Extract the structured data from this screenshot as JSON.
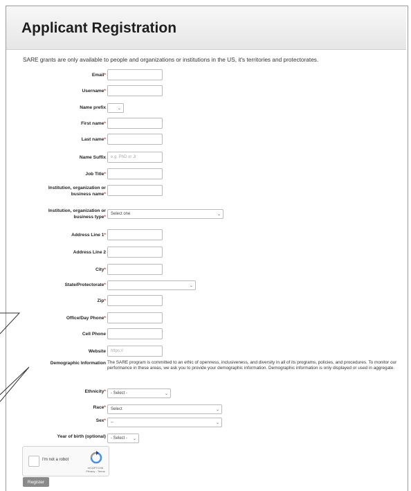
{
  "page": {
    "title": "Applicant Registration",
    "intro": "SARE grants are only available to people and organizations or institutions in the US, it's territories and protectorates."
  },
  "fields": [
    {
      "label": "Email",
      "required": true,
      "type": "text",
      "placeholder": ""
    },
    {
      "label": "Username",
      "required": true,
      "type": "text",
      "placeholder": ""
    },
    {
      "label": "Name prefix",
      "required": false,
      "type": "select-small",
      "value": ""
    },
    {
      "label": "First name",
      "required": true,
      "type": "text",
      "placeholder": ""
    },
    {
      "label": "Last name",
      "required": true,
      "type": "text",
      "placeholder": ""
    },
    {
      "label": "Name Suffix",
      "required": false,
      "type": "text",
      "placeholder": "e.g. PhD or Jr"
    },
    {
      "label": "Job Title",
      "required": true,
      "type": "text",
      "placeholder": ""
    },
    {
      "label": "Institution, organization or business name",
      "required": true,
      "type": "text",
      "placeholder": ""
    },
    {
      "label": "Institution, organization or business type",
      "required": true,
      "type": "select",
      "value": "Select one"
    },
    {
      "label": "Address Line 1",
      "required": true,
      "type": "text",
      "placeholder": ""
    },
    {
      "label": "Address Line 2",
      "required": false,
      "type": "text",
      "placeholder": ""
    },
    {
      "label": "City",
      "required": true,
      "type": "text",
      "placeholder": ""
    },
    {
      "label": "State/Protectorate",
      "required": true,
      "type": "select",
      "value": ""
    },
    {
      "label": "Zip",
      "required": true,
      "type": "text",
      "placeholder": ""
    },
    {
      "label": "Office/Day Phone",
      "required": true,
      "type": "text",
      "placeholder": ""
    },
    {
      "label": "Cell Phone",
      "required": false,
      "type": "text",
      "placeholder": ""
    },
    {
      "label": "Website",
      "required": false,
      "type": "text",
      "placeholder": "https://"
    }
  ],
  "demographic": {
    "label": "Demographic Information",
    "text": "The SARE program is committed to an ethic of openness, inclusiveness, and diversity in all of its programs, policies, and procedures. To monitor our performance in these areas, we ask you to provide your demographic information. Demographic information is only displayed or used in aggregate."
  },
  "demo_fields": [
    {
      "label": "Ethnicity",
      "required": true,
      "value": "- Select -"
    },
    {
      "label": "Race",
      "required": true,
      "value": "Select"
    },
    {
      "label": "Sex",
      "required": true,
      "value": "--"
    },
    {
      "label": "Year of birth (optional)",
      "required": false,
      "value": "- Select -"
    }
  ],
  "captcha": {
    "label": "I'm not a robot",
    "brand": "reCAPTCHA",
    "links": "Privacy - Terms"
  },
  "register_label": "Register",
  "required_mark": "*"
}
